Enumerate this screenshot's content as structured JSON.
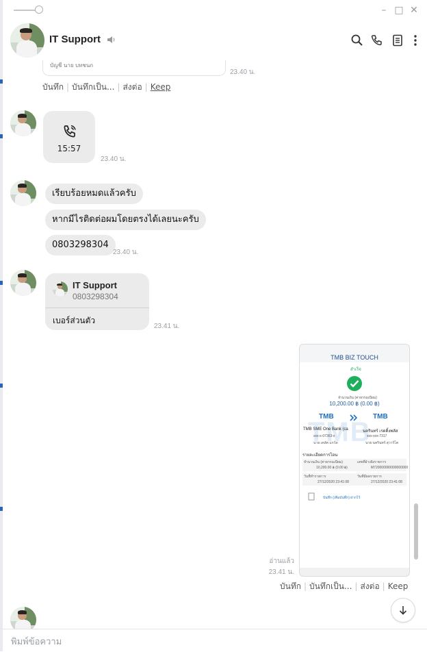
{
  "window": {
    "minimize_label": "–",
    "maximize_label": "□",
    "close_label": "✕"
  },
  "header": {
    "title": "IT Support",
    "icons": [
      "search-icon",
      "phone-icon",
      "notes-icon",
      "more-icon"
    ]
  },
  "colors": {
    "accent": "#1a6fc4",
    "bubble": "#ebebeb",
    "timestamp": "#9aa0a6",
    "success": "#1fae5b"
  },
  "messages": {
    "top_actions": {
      "save": "บันทึก",
      "save_as": "บันทึกเป็น...",
      "forward": "ส่งต่อ",
      "keep": "Keep"
    },
    "top_time": "23.40 น.",
    "top_card_snippet": "บัญชี นาย บทชนก",
    "call": {
      "duration": "15:57",
      "time": "23.40 น."
    },
    "text_bubbles": [
      "เรียบร้อยหมดแล้วครับ",
      "หากมีไรติดต่อผมโดยตรงได้เลยนะครับ",
      "0803298304"
    ],
    "text_time": "23.40 น.",
    "contact": {
      "name": "IT Support",
      "number": "0803298304",
      "label": "เบอร์ส่วนตัว",
      "time": "23.41 น."
    },
    "receipt": {
      "title": "TMB BIZ TOUCH",
      "status": "สำเร็จ",
      "amount_label": "จำนวนเงิน (ค่าธรรมเนียม)",
      "amount": "10,200.00 ฿ (0.00 ฿)",
      "from_bank": "TMB SME One Bank (ca",
      "from_acct": "xxx-x-07363-x",
      "from_name": "นาย เคลัค แกว์ด",
      "to_bank": "นครินทร์ เรดดิ้งพลัส",
      "to_acct": "xxx-xxx-7317",
      "to_name": "นาย นครินทร์ สุวาร์โต",
      "details_title": "รายละเอียดการโอน",
      "detail_amount_label": "จำนวนเงิน (ค่าธรรมเนียม)",
      "detail_amount": "10,200.00 ฿ (0.00 ฿)",
      "detail_ref_label": "เลขที่อ้างอิงรายการ",
      "detail_ref": "M720000000000000000",
      "detail_date_label": "วันที่ทำรายการ",
      "detail_date": "27/12/2020 23:41:08",
      "detail_eff_label": "วันที่มีผลรายการ",
      "detail_eff": "27/12/2020 23:41:08",
      "note": "บันทึก (เพิ่มบันทึก) ฝากไว้",
      "watermark": "TMB"
    },
    "receipt_read": "อ่านแล้ว",
    "receipt_time": "23.41 น.",
    "receipt_actions": {
      "save": "บันทึก",
      "save_as": "บันทึกเป็น...",
      "forward": "ส่งต่อ",
      "keep": "Keep"
    }
  },
  "input": {
    "placeholder": "พิมพ์ข้อความ"
  }
}
